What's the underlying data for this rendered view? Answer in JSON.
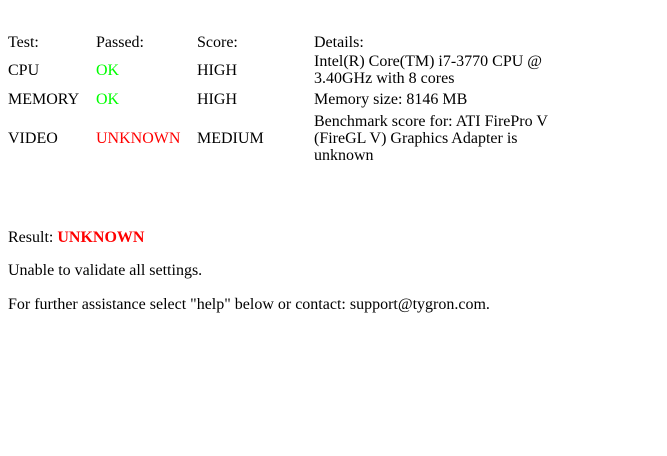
{
  "table": {
    "headers": {
      "test": "Test:",
      "passed": "Passed:",
      "score": "Score:",
      "details": "Details:"
    },
    "rows": [
      {
        "test": "CPU",
        "passed": "OK",
        "score": "HIGH",
        "details": "Intel(R) Core(TM) i7-3770 CPU @ 3.40GHz with 8 cores"
      },
      {
        "test": "MEMORY",
        "passed": "OK",
        "score": "HIGH",
        "details": "Memory size: 8146 MB"
      },
      {
        "test": "VIDEO",
        "passed": "UNKNOWN",
        "score": "MEDIUM",
        "details": "Benchmark score for: ATI FirePro V (FireGL V) Graphics Adapter is unknown"
      }
    ]
  },
  "result": {
    "label": "Result: ",
    "value": "UNKNOWN"
  },
  "message": "Unable to validate all settings.",
  "contact": "For further assistance select \"help\" below or contact: support@tygron.com.",
  "colors": {
    "ok": "#00ff00",
    "unknown": "#ff0000"
  }
}
